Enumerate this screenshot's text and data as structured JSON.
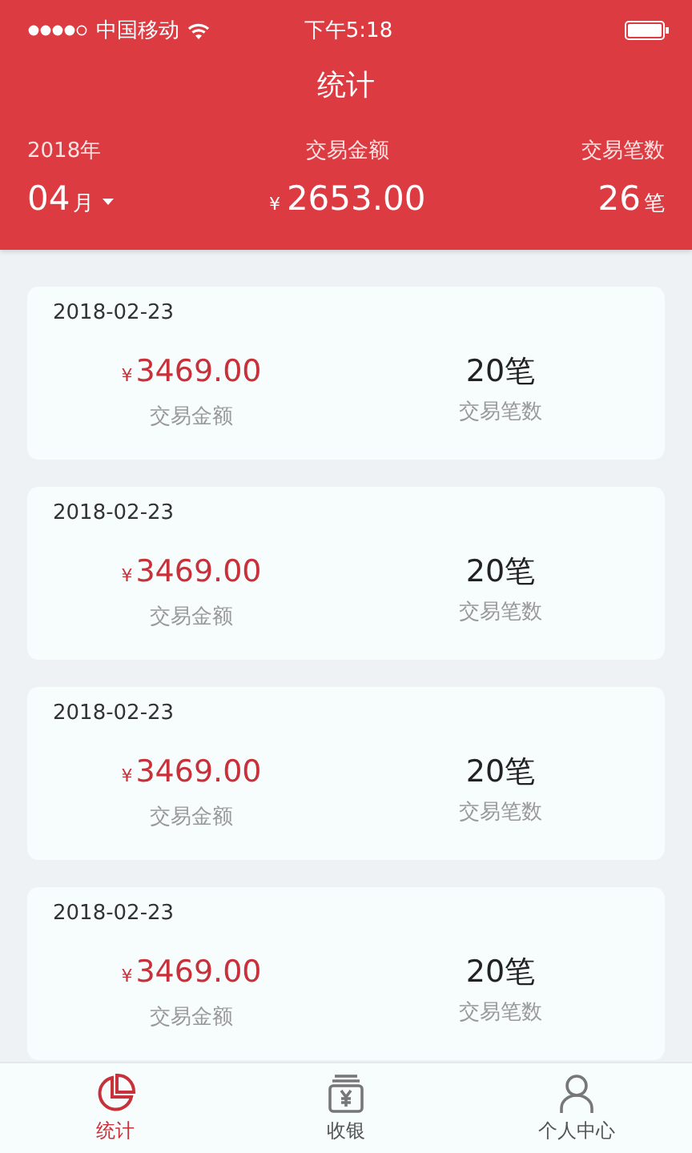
{
  "status_bar": {
    "carrier": "中国移动",
    "time": "下午5:18"
  },
  "title": "统计",
  "summary": {
    "year": "2018年",
    "month": "04",
    "month_unit": "月",
    "amount_label": "交易金额",
    "currency": "¥",
    "amount": "2653.00",
    "count_label": "交易笔数",
    "count": "26",
    "count_unit": "笔"
  },
  "records": [
    {
      "date": "2018-02-23",
      "currency": "¥",
      "amount": "3469.00",
      "amount_label": "交易金额",
      "count": "20笔",
      "count_label": "交易笔数"
    },
    {
      "date": "2018-02-23",
      "currency": "¥",
      "amount": "3469.00",
      "amount_label": "交易金额",
      "count": "20笔",
      "count_label": "交易笔数"
    },
    {
      "date": "2018-02-23",
      "currency": "¥",
      "amount": "3469.00",
      "amount_label": "交易金额",
      "count": "20笔",
      "count_label": "交易笔数"
    },
    {
      "date": "2018-02-23",
      "currency": "¥",
      "amount": "3469.00",
      "amount_label": "交易金额",
      "count": "20笔",
      "count_label": "交易笔数"
    }
  ],
  "tabs": [
    {
      "kind": "stats",
      "label": "统计",
      "selected": true
    },
    {
      "kind": "cashier",
      "label": "收银",
      "selected": false
    },
    {
      "kind": "profile",
      "label": "个人中心",
      "selected": false
    }
  ]
}
